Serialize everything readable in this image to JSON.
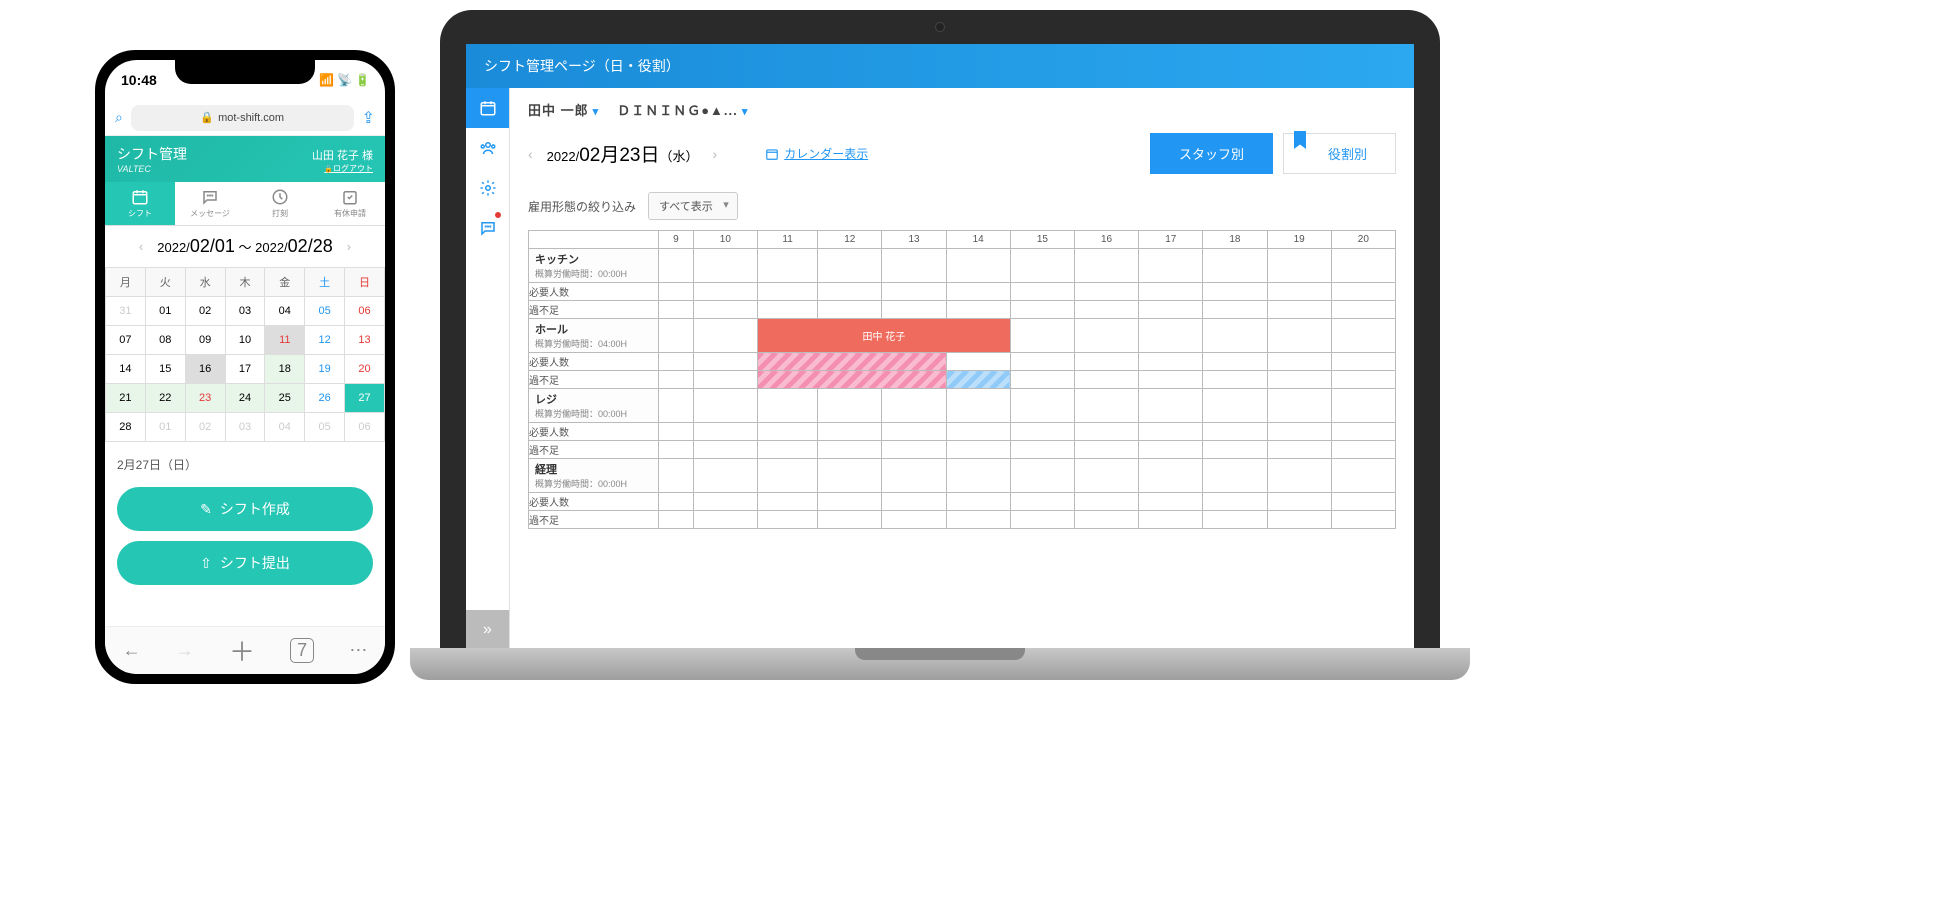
{
  "phone": {
    "time": "10:48",
    "url_prefix": "🔒",
    "url": "mot-shift.com",
    "header_title": "シフト管理",
    "brand": "VALTEC",
    "user": "山田 花子 様",
    "logout": "ログアウト",
    "tabs": [
      "シフト",
      "メッセージ",
      "打刻",
      "有休申請"
    ],
    "range_prev": "‹",
    "range_next": "›",
    "range": {
      "y1": "2022/",
      "d1": "02/01",
      "tilde": "～",
      "y2": "2022/",
      "d2": "02/28"
    },
    "weekdays": [
      "月",
      "火",
      "水",
      "木",
      "金",
      "土",
      "日"
    ],
    "selected_label": "2月27日（日）",
    "btn_create": "シフト作成",
    "btn_submit": "シフト提出",
    "tabs_count": "7",
    "calendar": [
      [
        {
          "d": "31",
          "cls": "dim"
        },
        {
          "d": "01"
        },
        {
          "d": "02"
        },
        {
          "d": "03"
        },
        {
          "d": "04"
        },
        {
          "d": "05",
          "cls": "sat"
        },
        {
          "d": "06",
          "cls": "sun"
        }
      ],
      [
        {
          "d": "07"
        },
        {
          "d": "08"
        },
        {
          "d": "09"
        },
        {
          "d": "10"
        },
        {
          "d": "11",
          "cls": "sun sel"
        },
        {
          "d": "12",
          "cls": "sat"
        },
        {
          "d": "13",
          "cls": "sun"
        }
      ],
      [
        {
          "d": "14"
        },
        {
          "d": "15"
        },
        {
          "d": "16",
          "cls": "sel"
        },
        {
          "d": "17"
        },
        {
          "d": "18",
          "cls": "hl-green"
        },
        {
          "d": "19",
          "cls": "sat"
        },
        {
          "d": "20",
          "cls": "sun"
        }
      ],
      [
        {
          "d": "21",
          "cls": "hl-green"
        },
        {
          "d": "22",
          "cls": "hl-green"
        },
        {
          "d": "23",
          "cls": "sun hl-green"
        },
        {
          "d": "24",
          "cls": "hl-green"
        },
        {
          "d": "25",
          "cls": "hl-green"
        },
        {
          "d": "26",
          "cls": "sat"
        },
        {
          "d": "27",
          "cls": "hl-teal"
        }
      ],
      [
        {
          "d": "28"
        },
        {
          "d": "01",
          "cls": "dim"
        },
        {
          "d": "02",
          "cls": "dim"
        },
        {
          "d": "03",
          "cls": "dim"
        },
        {
          "d": "04",
          "cls": "dim"
        },
        {
          "d": "05",
          "cls": "dim sat"
        },
        {
          "d": "06",
          "cls": "dim sun"
        }
      ]
    ]
  },
  "laptop": {
    "page_title": "シフト管理ページ（日・役割）",
    "dropdowns": [
      "田中 一郎",
      "ＤＩＮＩＮＧ●▲..."
    ],
    "date": {
      "y": "2022/",
      "d": "02月23日",
      "w": "（水）"
    },
    "cal_link": "カレンダー表示",
    "view_tabs": {
      "staff": "スタッフ別",
      "role": "役割別"
    },
    "filter_label": "雇用形態の絞り込み",
    "filter_value": "すべて表示",
    "hours": [
      "9",
      "10",
      "11",
      "12",
      "13",
      "14",
      "15",
      "16",
      "17",
      "18",
      "19",
      "20"
    ],
    "rows": {
      "req": "必要人数",
      "short": "過不足"
    },
    "roles": [
      {
        "name": "キッチン",
        "sub": "概算労働時間：00:00H"
      },
      {
        "name": "ホール",
        "sub": "概算労働時間：04:00H",
        "bar_label": "田中 花子",
        "bar_from": 2,
        "bar_span": 4,
        "req_from": 2,
        "req_span": 3,
        "short_from": 5,
        "short_span": 1
      },
      {
        "name": "レジ",
        "sub": "概算労働時間：00:00H"
      },
      {
        "name": "経理",
        "sub": "概算労働時間：00:00H"
      }
    ]
  }
}
